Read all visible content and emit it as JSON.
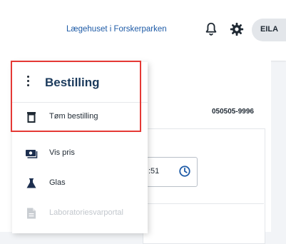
{
  "header": {
    "clinic_name": "Lægehuset i Forskerparken",
    "user_initials": "EILA"
  },
  "content": {
    "patient_code": "050505-9996",
    "time_fragment": ":51"
  },
  "menu": {
    "title": "Bestilling",
    "items": [
      {
        "label": "Tøm bestilling",
        "icon": "trash-icon",
        "enabled": true
      },
      {
        "label": "Vis pris",
        "icon": "money-icon",
        "enabled": true
      },
      {
        "label": "Glas",
        "icon": "flask-icon",
        "enabled": true
      },
      {
        "label": "Laboratoriesvarportal",
        "icon": "file-icon",
        "enabled": false
      }
    ]
  },
  "colors": {
    "accent": "#1d5aa6",
    "highlight": "#e53935",
    "text": "#1f2933"
  }
}
